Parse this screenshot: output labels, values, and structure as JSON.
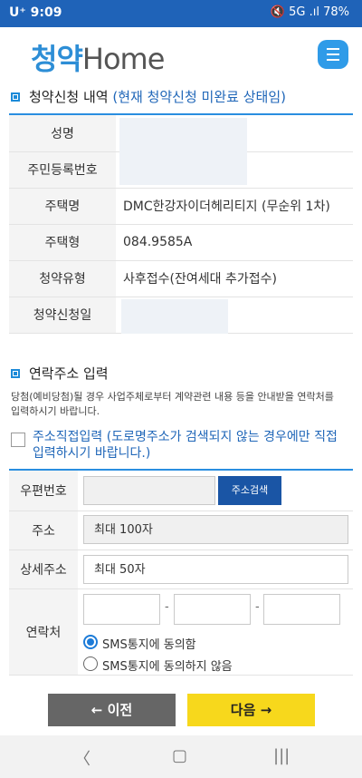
{
  "status": {
    "carrier": "U⁺ 9:09",
    "icons": "🔇 5G .ıl 78%",
    "battery_icon": "battery-icon"
  },
  "header": {
    "logo_cheongyak": "청약",
    "logo_home": "Home"
  },
  "section1": {
    "title": "청약신청 내역",
    "subtitle": "(현재 청약신청 미완료 상태임)"
  },
  "info_rows": [
    {
      "label": "성명",
      "value": ""
    },
    {
      "label": "주민등록번호",
      "value": ""
    },
    {
      "label": "주택명",
      "value": "DMC한강자이더헤리티지 (무순위 1차)"
    },
    {
      "label": "주택형",
      "value": "084.9585A"
    },
    {
      "label": "청약유형",
      "value": "사후접수(잔여세대 추가접수)"
    },
    {
      "label": "청약신청일",
      "value": ""
    }
  ],
  "section2": {
    "title": "연락주소 입력",
    "note": "당첨(예비당첨)될 경우 사업주체로부터 계약관련 내용 등을 안내받을 연락처를 입력하시기 바랍니다.",
    "direct_input_label": "주소직접입력 (도로명주소가 검색되지 않는 경우에만 직접 입력하시기 바랍니다.)"
  },
  "form": {
    "postcode_label": "우편번호",
    "postcode_value": "",
    "search_button": "주소검색",
    "address_label": "주소",
    "address_placeholder": "최대 100자",
    "detail_label": "상세주소",
    "detail_placeholder": "최대 50자",
    "contact_label": "연락처",
    "dash": "-",
    "sms_agree": "SMS통지에 동의함",
    "sms_disagree": "SMS통지에 동의하지 않음"
  },
  "buttons": {
    "prev": "← 이전",
    "next": "다음 →"
  },
  "navbar": {
    "back": "〈",
    "home": "▢",
    "recent": "|||"
  }
}
